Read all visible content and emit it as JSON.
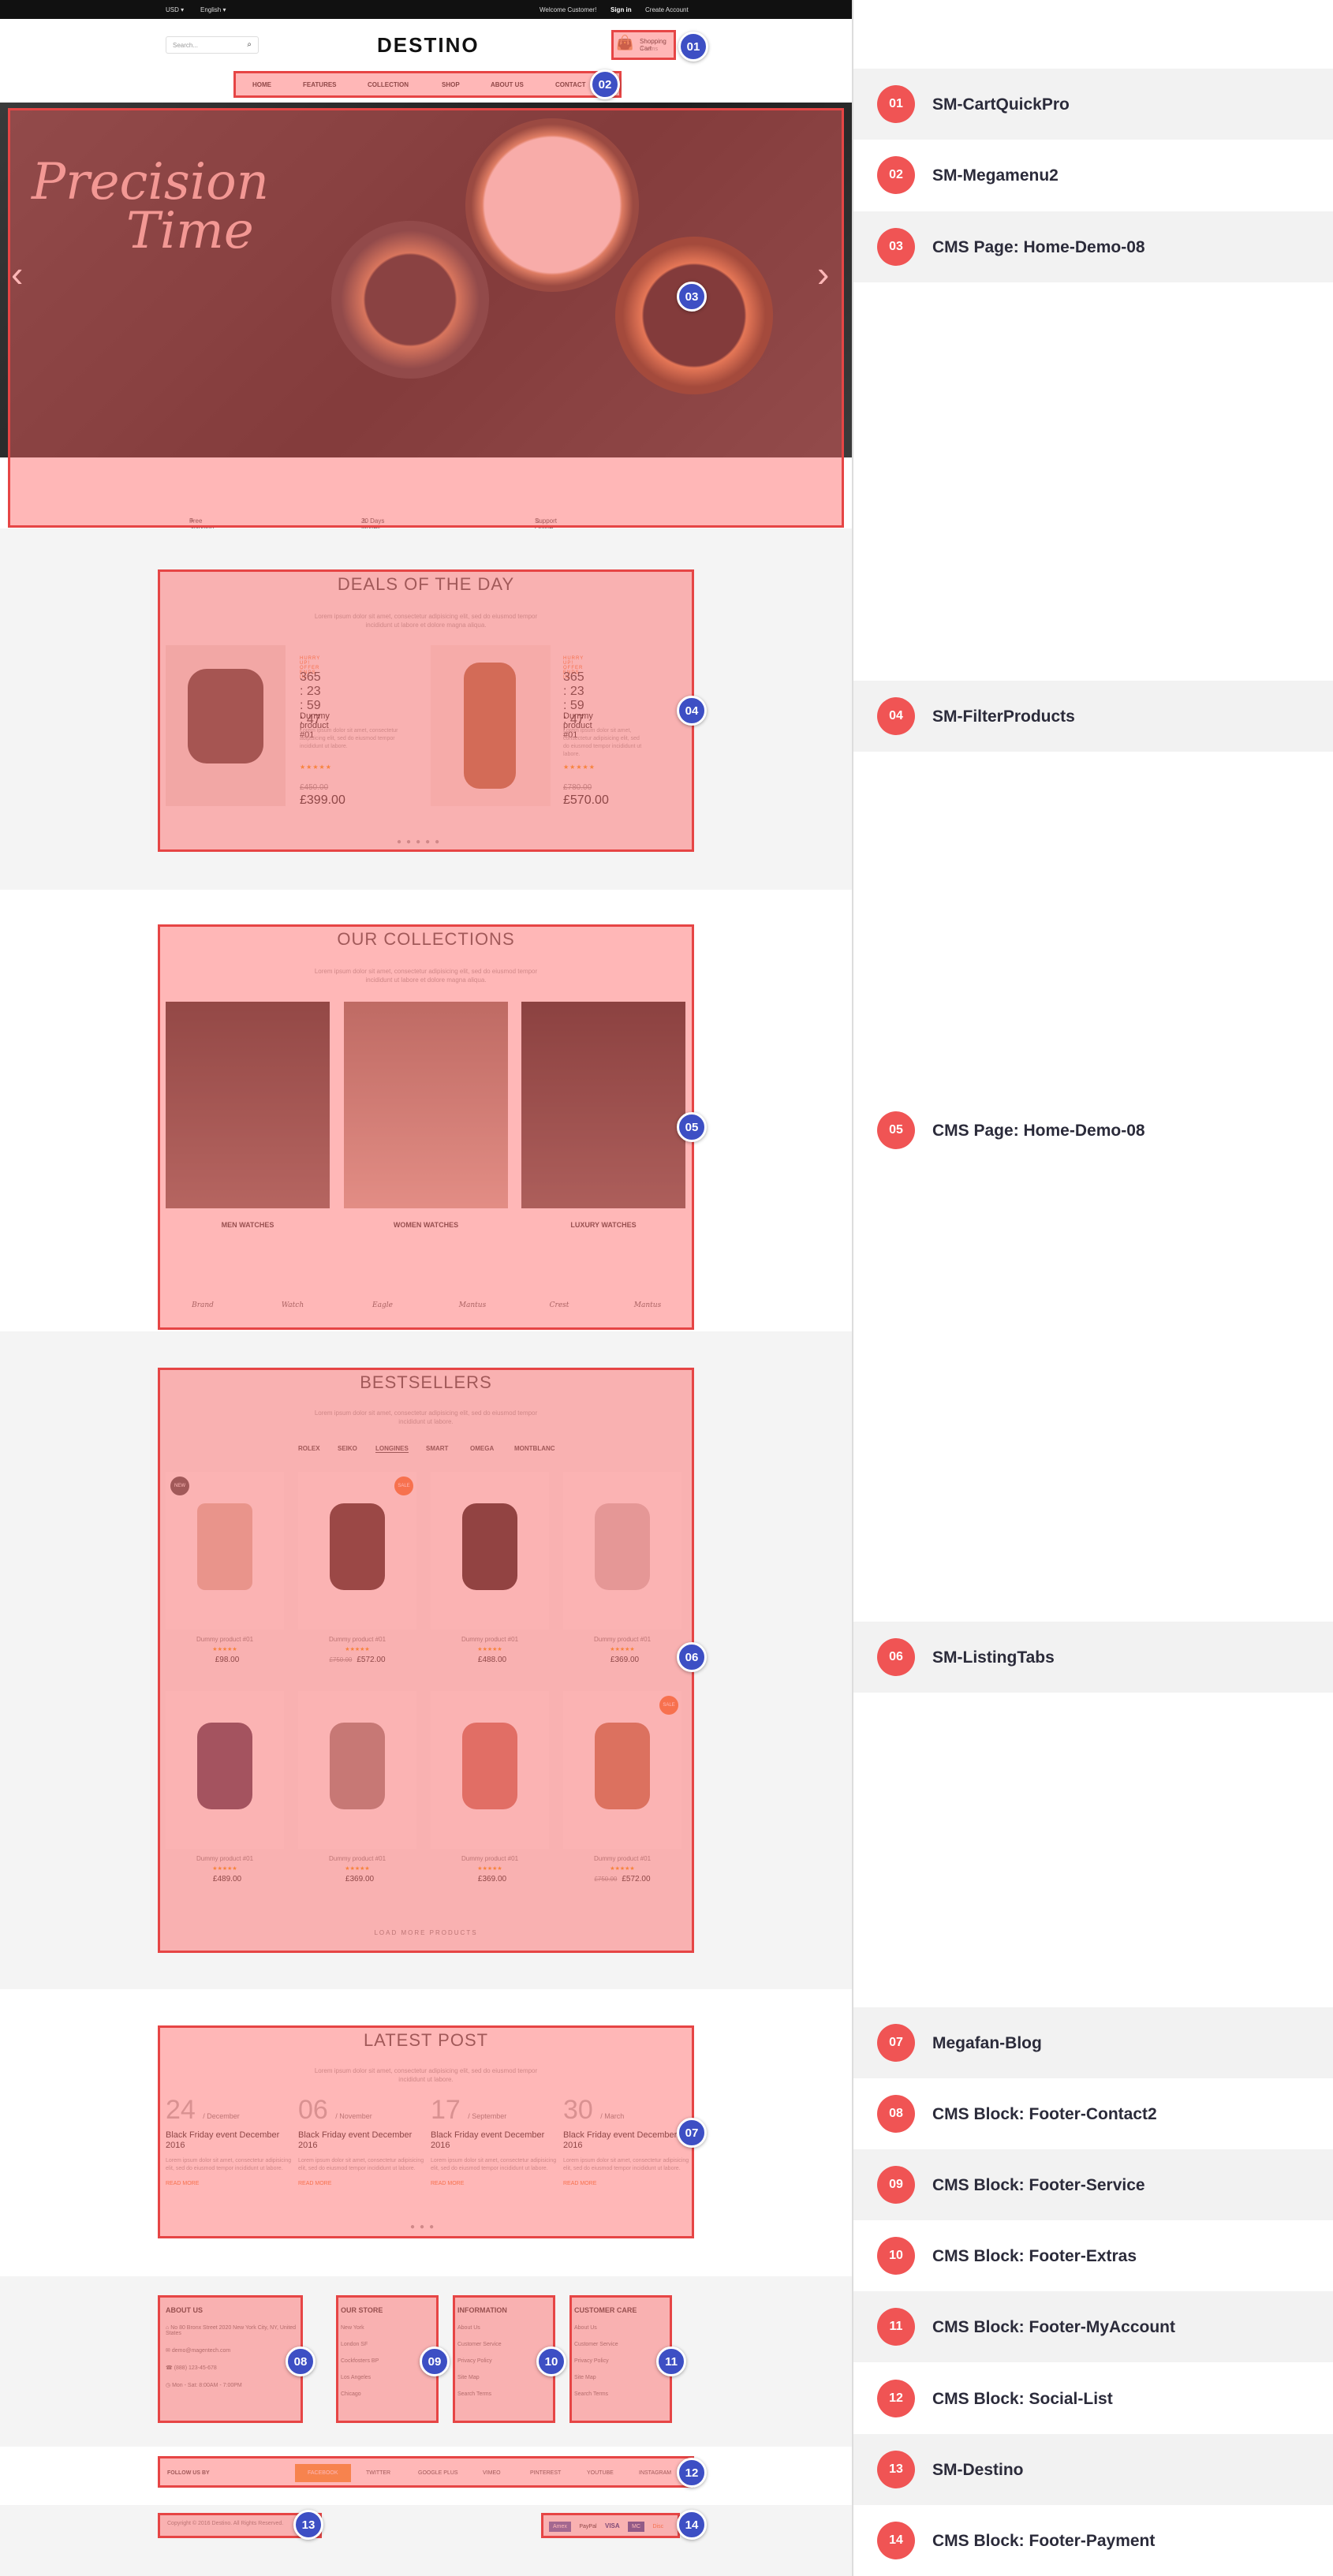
{
  "topbar": {
    "currency": "USD ▾",
    "language": "English ▾",
    "welcome": "Welcome Customer!",
    "signin": "Sign in",
    "create": "Create Account"
  },
  "header": {
    "search_placeholder": "Search...",
    "logo": "DESTINO",
    "cart_label": "Shopping Cart",
    "cart_count": "0 Items"
  },
  "menu": [
    "HOME",
    "FEATURES",
    "COLLECTION",
    "SHOP",
    "ABOUT US",
    "CONTACT"
  ],
  "hero": {
    "script_line1": "Precision",
    "script_line2": "Time"
  },
  "services": [
    "Free Shipping on Orders Over $99",
    "30 Days Money Back Guarantee",
    "Support Online 24/24 All Day"
  ],
  "deals": {
    "title": "DEALS OF THE DAY",
    "subtitle": "Lorem ipsum dolor sit amet, consectetur adipisicing elit, sed do eiusmod tempor incididunt ut labore et dolore magna aliqua.",
    "items": [
      {
        "name": "Dummy product #01",
        "old": "£450.00",
        "price": "£399.00",
        "timer": [
          "365",
          "23",
          "59",
          "47"
        ]
      },
      {
        "name": "Dummy product #01",
        "old": "£780.00",
        "price": "£570.00",
        "timer": [
          "365",
          "23",
          "59",
          "47"
        ]
      }
    ],
    "timer_units": [
      "DAYS",
      "HOURS",
      "MINS",
      "SECS"
    ],
    "desc": "Lorem ipsum dolor sit amet, consectetur adipisicing elit, sed do eiusmod tempor incididunt ut labore.",
    "hurry": "HURRY UP! OFFER ENDS IN:"
  },
  "collections": {
    "title": "OUR COLLECTIONS",
    "subtitle": "Lorem ipsum dolor sit amet, consectetur adipisicing elit, sed do eiusmod tempor incididunt ut labore et dolore magna aliqua.",
    "items": [
      "MEN WATCHES",
      "WOMEN WATCHES",
      "LUXURY WATCHES"
    ],
    "brands": [
      "Brand",
      "Watch",
      "Eagle",
      "Mantus",
      "Crest",
      "Mantus"
    ]
  },
  "bestsellers": {
    "title": "BESTSELLERS",
    "subtitle": "Lorem ipsum dolor sit amet, consectetur adipisicing elit, sed do eiusmod tempor incididunt ut labore.",
    "tabs": [
      "ROLEX",
      "SEIKO",
      "LONGINES",
      "SMART",
      "OMEGA",
      "MONTBLANC"
    ],
    "products": [
      {
        "name": "Dummy product #01",
        "price": "£98.00",
        "old": ""
      },
      {
        "name": "Dummy product #01",
        "price": "£572.00",
        "old": "£750.00"
      },
      {
        "name": "Dummy product #01",
        "price": "£488.00",
        "old": ""
      },
      {
        "name": "Dummy product #01",
        "price": "£369.00",
        "old": ""
      },
      {
        "name": "Dummy product #01",
        "price": "£489.00",
        "old": ""
      },
      {
        "name": "Dummy product #01",
        "price": "£369.00",
        "old": ""
      },
      {
        "name": "Dummy product #01",
        "price": "£369.00",
        "old": ""
      },
      {
        "name": "Dummy product #01",
        "price": "£572.00",
        "old": "£750.00"
      }
    ],
    "more": "LOAD MORE PRODUCTS",
    "tag_new": "NEW",
    "tag_sale": "SALE"
  },
  "blog": {
    "title": "LATEST POST",
    "subtitle": "Lorem ipsum dolor sit amet, consectetur adipisicing elit, sed do eiusmod tempor incididunt ut labore.",
    "posts": [
      {
        "day": "24",
        "month": "/ December",
        "title": "Black Friday event December 2016"
      },
      {
        "day": "06",
        "month": "/ November",
        "title": "Black Friday event December 2016"
      },
      {
        "day": "17",
        "month": "/ September",
        "title": "Black Friday event December 2016"
      },
      {
        "day": "30",
        "month": "/ March",
        "title": "Black Friday event December 2016"
      }
    ],
    "excerpt": "Lorem ipsum dolor sit amet, consectetur adipisicing elit, sed do eiusmod tempor incididunt ut labore.",
    "read": "READ MORE"
  },
  "footer": {
    "about": {
      "title": "ABOUT US",
      "lines": [
        "No 80 Bronx Street 2020 New York City, NY, United States",
        "demo@magentech.com",
        "(888) 123-45-678",
        "Mon - Sat: 8:00AM - 7:00PM"
      ]
    },
    "store": {
      "title": "OUR STORE",
      "lines": [
        "New York",
        "London SF",
        "Cockfosters BP",
        "Los Angeles",
        "Chicago"
      ]
    },
    "info": {
      "title": "INFORMATION",
      "lines": [
        "About Us",
        "Customer Service",
        "Privacy Policy",
        "Site Map",
        "Search Terms"
      ]
    },
    "care": {
      "title": "CUSTOMER CARE",
      "lines": [
        "About Us",
        "Customer Service",
        "Privacy Policy",
        "Site Map",
        "Search Terms"
      ]
    },
    "follow_label": "FOLLOW US BY",
    "socials": [
      "FACEBOOK",
      "TWITTER",
      "GOOGLE PLUS",
      "VIMEO",
      "PINTEREST",
      "YOUTUBE",
      "INSTAGRAM"
    ],
    "copyright": "Copyright © 2016 Destino. All Rights Reserved.",
    "payments": [
      "Amex",
      "PayPal",
      "VISA",
      "MC",
      "Disc"
    ]
  },
  "legend": [
    {
      "num": "01",
      "name": "SM-CartQuickPro"
    },
    {
      "num": "02",
      "name": "SM-Megamenu2"
    },
    {
      "num": "03",
      "name": "CMS Page: Home-Demo-08"
    },
    {
      "num": "04",
      "name": "SM-FilterProducts"
    },
    {
      "num": "05",
      "name": "CMS Page: Home-Demo-08"
    },
    {
      "num": "06",
      "name": "SM-ListingTabs"
    },
    {
      "num": "07",
      "name": "Megafan-Blog"
    },
    {
      "num": "08",
      "name": "CMS Block: Footer-Contact2"
    },
    {
      "num": "09",
      "name": "CMS Block: Footer-Service"
    },
    {
      "num": "10",
      "name": "CMS Block: Footer-Extras"
    },
    {
      "num": "11",
      "name": "CMS Block: Footer-MyAccount"
    },
    {
      "num": "12",
      "name": "CMS Block: Social-List"
    },
    {
      "num": "13",
      "name": "SM-Destino"
    },
    {
      "num": "14",
      "name": "CMS Block: Footer-Payment"
    }
  ],
  "colors": {
    "overlay": "#ff5f5f",
    "badge": "#3d4fc4",
    "legend_circle": "#f05454"
  }
}
